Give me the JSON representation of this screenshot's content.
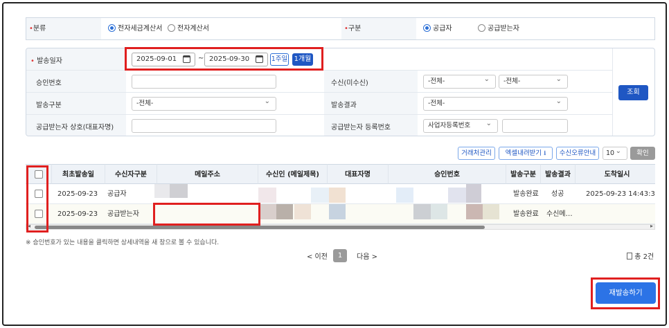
{
  "classification": {
    "label": "분류",
    "options": [
      {
        "label": "전자세금계산서",
        "selected": true
      },
      {
        "label": "전자계산서",
        "selected": false
      }
    ],
    "type_label": "구분",
    "type_options": [
      {
        "label": "공급자",
        "selected": true
      },
      {
        "label": "공급받는자",
        "selected": false
      }
    ]
  },
  "search": {
    "send_date_label": "발송일자",
    "date_from": "2025-09-01",
    "date_separator": "~",
    "date_to": "2025-09-30",
    "week_button": "1주일",
    "month_button": "1개월",
    "approval_label": "승인번호",
    "receive_label": "수신(미수신)",
    "receive_select1": "-전체-",
    "receive_select2": "-전체-",
    "send_type_label": "발송구분",
    "send_type_value": "-전체-",
    "send_result_label": "발송결과",
    "send_result_value": "-전체-",
    "buyer_name_label": "공급받는자 상호(대표자명)",
    "buyer_reg_label": "공급받는자 등록번호",
    "buyer_reg_type": "사업자등록번호",
    "search_button": "조회"
  },
  "toolbar": {
    "partner_button": "거래처관리",
    "excel_button": "엑셀내려받기",
    "receive_error_button": "수신오류안내",
    "page_size": "10",
    "confirm_button": "확인"
  },
  "table": {
    "headers": [
      "최초발송일",
      "수신자구분",
      "메일주소",
      "수신인 (메일제목)",
      "대표자명",
      "승인번호",
      "발송구분",
      "발송결과",
      "도착일시"
    ],
    "rows": [
      {
        "date": "2025-09-23",
        "receiver_type": "공급자",
        "send_type": "발송완료",
        "result": "성공",
        "arrived": "2025-09-23 14:43:30"
      },
      {
        "date": "2025-09-23",
        "receiver_type": "공급받는자",
        "send_type": "발송완료",
        "result": "수신메…",
        "arrived": ""
      }
    ]
  },
  "note": "※ 승인번호가 있는 내용을 클릭하면 상세내역을 새 창으로 볼 수 있습니다.",
  "pagination": {
    "prev": "< 이전",
    "current": "1",
    "next": "다음 >",
    "total": "총 2건"
  },
  "resend_button": "재발송하기",
  "colors": {
    "primary": "#1f57c3",
    "accent_button": "#2c73e6",
    "highlight": "#e01f1f"
  }
}
